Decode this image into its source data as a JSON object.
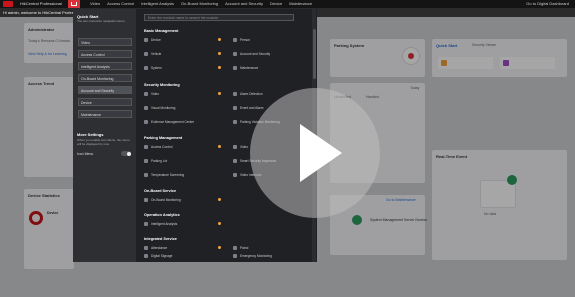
{
  "header": {
    "product": "HikCentral Professional",
    "nav": [
      "Video",
      "Access Control",
      "Intelligent Analysis",
      "On-Board Monitoring",
      "Account and Security",
      "Device",
      "Maintenance"
    ],
    "right_link": "Go to Digital Dashboard",
    "welcome": "Hi admin, welcome to HikCentral Professional!"
  },
  "dashboard": {
    "admin_label": "Administrator",
    "today_text": "Today's Remains 0 Unread",
    "view_link": "View Help & for Learning",
    "alarm_trend": "Access Trend",
    "device_statistics": "Device Statistics",
    "device_label": "Device",
    "device_abnormal": "Abnormal",
    "device_exception": "Exception",
    "parking_system": "Parking System",
    "quick_start": "Quick Start",
    "security_viewer": "Security Viewer",
    "real_time_event": "Real-Time Event",
    "today_select": "Today",
    "unhandled": "Unhandled",
    "handled": "Handled",
    "go_maintenance": "Go to Maintenance",
    "system_server_normal": "System Management Server Normal",
    "no_data": "No data"
  },
  "menu": {
    "quick_start_title": "Quick Start",
    "quick_start_desc": "You can customize navigation items.",
    "left_items": [
      "Video",
      "Access Control",
      "Intelligent Analysis",
      "On-Board Monitoring",
      "Account and Security",
      "Device",
      "Maintenance"
    ],
    "more_settings_title": "More Settings",
    "more_settings_desc": "When you enable Icon Menu, the menu will be displayed by icon.",
    "icon_menu_label": "Icon Menu",
    "search_placeholder": "Enter the module name to search the module",
    "sections": [
      {
        "title": "Basic Management",
        "items": [
          "Device",
          "Person",
          "Vehicle",
          "Account and Security",
          "System",
          "Maintenance"
        ]
      },
      {
        "title": "Security Monitoring",
        "items": [
          "Video",
          "Alarm Detection",
          "Visual Monitoring",
          "Event and Alarm",
          "Evidence Management Center",
          "Parking Violation Monitoring"
        ]
      },
      {
        "title": "Parking Management",
        "items": [
          "Access Control",
          "Video",
          "Parking Lot",
          "Smart Security Inspection",
          "Temperature Screening",
          "Video Intercom"
        ]
      },
      {
        "title": "On-Board Service",
        "items": [
          "On-Board Monitoring"
        ]
      },
      {
        "title": "Operation Analytics",
        "items": [
          "Intelligent Analysis"
        ]
      },
      {
        "title": "Integrated Service",
        "items": [
          "Attendance",
          "Patrol",
          "Digital Signage",
          "Emergency Monitoring",
          "Audio Broadcast"
        ]
      }
    ]
  },
  "colors": {
    "accent": "#d9313a",
    "menu_bg": "#202124",
    "badge": "#f0a23c"
  }
}
